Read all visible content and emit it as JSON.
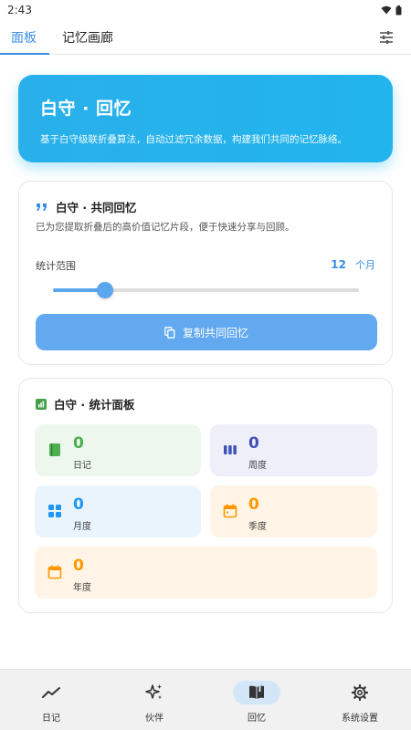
{
  "statusbar": {
    "time": "2:43"
  },
  "tabs": [
    {
      "label": "面板",
      "active": true
    },
    {
      "label": "记忆画廊",
      "active": false
    }
  ],
  "hero": {
    "title": "白守 · 回忆",
    "subtitle": "基于白守级联折叠算法，自动过滤冗余数据，构建我们共同的记忆脉络。"
  },
  "share_card": {
    "title": "白守 · 共同回忆",
    "description": "已为您提取折叠后的高价值记忆片段，便于快速分享与回顾。",
    "range_label": "统计范围",
    "range_value": "12",
    "range_unit": "个月",
    "slider_fraction": 0.17,
    "copy_label": "复制共同回忆"
  },
  "stats_card": {
    "title": "白守 · 统计面板",
    "items": [
      {
        "label": "日记",
        "value": "0",
        "color": "#4caf50",
        "bg": "#edf7ee",
        "icon": "book-icon"
      },
      {
        "label": "周度",
        "value": "0",
        "color": "#3f51b5",
        "bg": "#eeeff9",
        "icon": "bars-icon"
      },
      {
        "label": "月度",
        "value": "0",
        "color": "#2196f3",
        "bg": "#e9f4fd",
        "icon": "grid-icon"
      },
      {
        "label": "季度",
        "value": "0",
        "color": "#ff9800",
        "bg": "#fff4e5",
        "icon": "calendar-icon"
      },
      {
        "label": "年度",
        "value": "0",
        "color": "#ff9800",
        "bg": "#fff4e5",
        "icon": "calendar-icon"
      }
    ]
  },
  "bottom_nav": [
    {
      "label": "日记",
      "icon": "trend-icon",
      "active": false
    },
    {
      "label": "伙伴",
      "icon": "sparkle-icon",
      "active": false
    },
    {
      "label": "回忆",
      "icon": "open-book-icon",
      "active": true
    },
    {
      "label": "系统设置",
      "icon": "gear-icon",
      "active": false
    }
  ],
  "colors": {
    "accent": "#3a8ee6",
    "hero": "#22b4ec",
    "button": "#62a9f0"
  }
}
